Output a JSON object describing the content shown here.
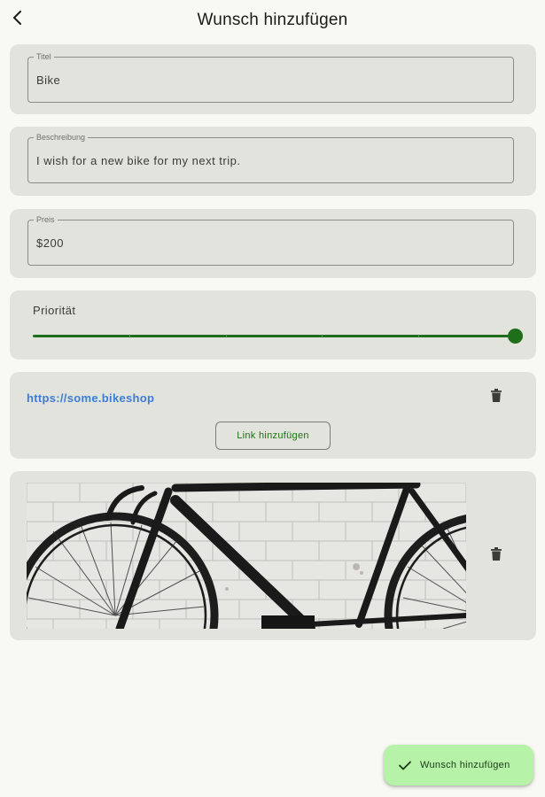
{
  "header": {
    "title": "Wunsch hinzufügen",
    "back_icon": "arrow-back-icon"
  },
  "form": {
    "title_field": {
      "label": "Titel",
      "value": "Bike"
    },
    "description_field": {
      "label": "Beschreibung",
      "value": "I wish for a new bike for my next trip."
    },
    "price_field": {
      "label": "Preis",
      "value": "$200"
    },
    "priority": {
      "label": "Priorität",
      "value_fraction": 1.0,
      "steps": 5
    }
  },
  "links": {
    "items": [
      {
        "url": "https://some.bikeshop"
      }
    ],
    "add_label": "Link hinzufügen",
    "delete_icon": "trash-icon"
  },
  "image": {
    "alt": "bike photo",
    "delete_icon": "trash-icon"
  },
  "fab": {
    "label": "Wunsch hinzufügen",
    "icon": "check-icon"
  },
  "colors": {
    "background": "#f8f9f2",
    "card": "#e2e3dc",
    "primary": "#1e6f1a",
    "link": "#3b7dd8",
    "fab": "#b7f2a9"
  }
}
